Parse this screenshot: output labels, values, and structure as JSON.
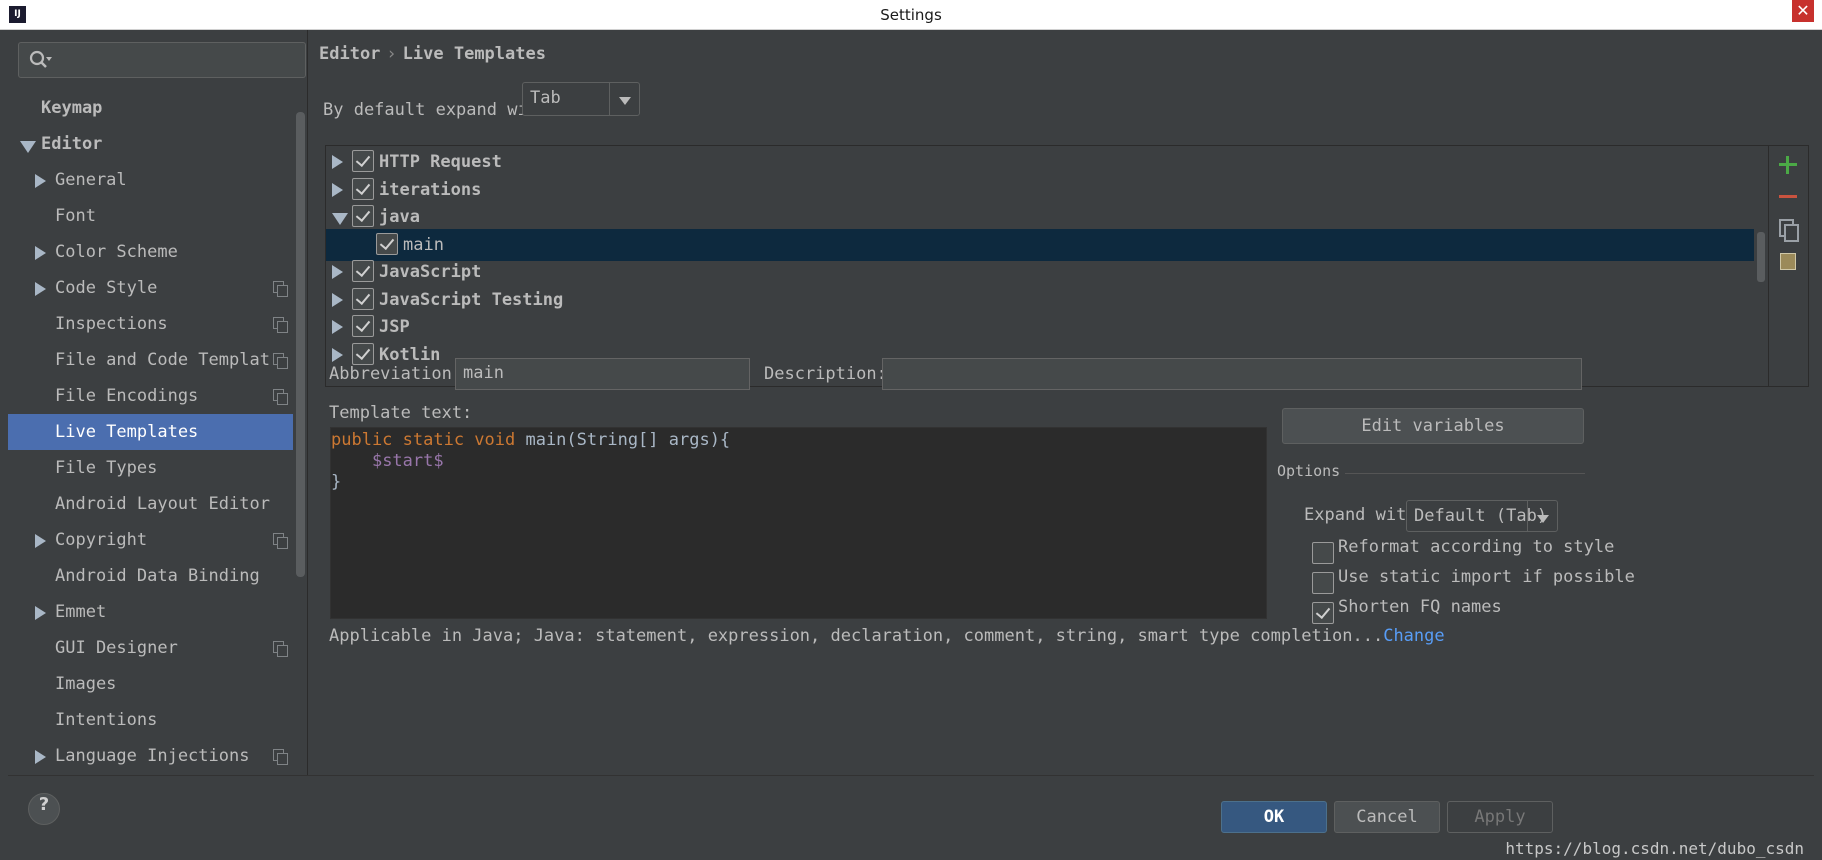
{
  "window": {
    "title": "Settings",
    "app_icon": "IJ"
  },
  "search": {
    "placeholder": ""
  },
  "sidebar": {
    "items": [
      {
        "label": "Keymap",
        "level": 0,
        "expander": "none",
        "bold": true,
        "selected": false,
        "has_copy_icon": false
      },
      {
        "label": "Editor",
        "level": 0,
        "expander": "down",
        "bold": true,
        "selected": false,
        "has_copy_icon": false
      },
      {
        "label": "General",
        "level": 1,
        "expander": "right",
        "bold": false,
        "selected": false,
        "has_copy_icon": false
      },
      {
        "label": "Font",
        "level": 1,
        "expander": "none",
        "bold": false,
        "selected": false,
        "has_copy_icon": false
      },
      {
        "label": "Color Scheme",
        "level": 1,
        "expander": "right",
        "bold": false,
        "selected": false,
        "has_copy_icon": false
      },
      {
        "label": "Code Style",
        "level": 1,
        "expander": "right",
        "bold": false,
        "selected": false,
        "has_copy_icon": true
      },
      {
        "label": "Inspections",
        "level": 1,
        "expander": "none",
        "bold": false,
        "selected": false,
        "has_copy_icon": true
      },
      {
        "label": "File and Code Templat",
        "level": 1,
        "expander": "none",
        "bold": false,
        "selected": false,
        "has_copy_icon": true
      },
      {
        "label": "File Encodings",
        "level": 1,
        "expander": "none",
        "bold": false,
        "selected": false,
        "has_copy_icon": true
      },
      {
        "label": "Live Templates",
        "level": 1,
        "expander": "none",
        "bold": false,
        "selected": true,
        "has_copy_icon": false
      },
      {
        "label": "File Types",
        "level": 1,
        "expander": "none",
        "bold": false,
        "selected": false,
        "has_copy_icon": false
      },
      {
        "label": "Android Layout Editor",
        "level": 1,
        "expander": "none",
        "bold": false,
        "selected": false,
        "has_copy_icon": false
      },
      {
        "label": "Copyright",
        "level": 1,
        "expander": "right",
        "bold": false,
        "selected": false,
        "has_copy_icon": true
      },
      {
        "label": "Android Data Binding",
        "level": 1,
        "expander": "none",
        "bold": false,
        "selected": false,
        "has_copy_icon": false
      },
      {
        "label": "Emmet",
        "level": 1,
        "expander": "right",
        "bold": false,
        "selected": false,
        "has_copy_icon": false
      },
      {
        "label": "GUI Designer",
        "level": 1,
        "expander": "none",
        "bold": false,
        "selected": false,
        "has_copy_icon": true
      },
      {
        "label": "Images",
        "level": 1,
        "expander": "none",
        "bold": false,
        "selected": false,
        "has_copy_icon": false
      },
      {
        "label": "Intentions",
        "level": 1,
        "expander": "none",
        "bold": false,
        "selected": false,
        "has_copy_icon": false
      },
      {
        "label": "Language Injections",
        "level": 1,
        "expander": "right",
        "bold": false,
        "selected": false,
        "has_copy_icon": true
      }
    ]
  },
  "breadcrumb": {
    "parent": "Editor",
    "separator": "›",
    "current": "Live Templates"
  },
  "expand": {
    "label": "By default expand with",
    "value": "Tab"
  },
  "templates": [
    {
      "label": "HTTP Request",
      "level": 0,
      "expander": "right",
      "checked": true,
      "bold": true,
      "selected": false
    },
    {
      "label": "iterations",
      "level": 0,
      "expander": "right",
      "checked": true,
      "bold": true,
      "selected": false
    },
    {
      "label": "java",
      "level": 0,
      "expander": "down",
      "checked": true,
      "bold": true,
      "selected": false
    },
    {
      "label": "main",
      "level": 1,
      "expander": "none",
      "checked": true,
      "bold": false,
      "selected": true
    },
    {
      "label": "JavaScript",
      "level": 0,
      "expander": "right",
      "checked": true,
      "bold": true,
      "selected": false
    },
    {
      "label": "JavaScript Testing",
      "level": 0,
      "expander": "right",
      "checked": true,
      "bold": true,
      "selected": false
    },
    {
      "label": "JSP",
      "level": 0,
      "expander": "right",
      "checked": true,
      "bold": true,
      "selected": false
    },
    {
      "label": "Kotlin",
      "level": 0,
      "expander": "right",
      "checked": true,
      "bold": true,
      "selected": false
    }
  ],
  "toolbar": {
    "add": "plus-icon",
    "remove": "minus-icon",
    "copy": "duplicate-icon",
    "restore": "restore-icon"
  },
  "form": {
    "abbreviation_label": "Abbreviation:",
    "abbreviation_value": "main",
    "description_label": "Description:",
    "description_value": "",
    "template_text_label": "Template text:"
  },
  "code": {
    "line1_kw": "public static void",
    "line1_rest": " main(String[] args){",
    "line2_indent": "    ",
    "line2_var": "$start$",
    "line3": "}"
  },
  "options": {
    "edit_variables_label": "Edit variables",
    "title": "Options",
    "expand_with_label": "Expand with",
    "expand_with_value": "Default (Tab)",
    "checkboxes": [
      {
        "label": "Reformat according to style",
        "checked": false
      },
      {
        "label": "Use static import if possible",
        "checked": false
      },
      {
        "label": "Shorten FQ names",
        "checked": true
      }
    ]
  },
  "applicable": {
    "text": "Applicable in Java; Java: statement, expression, declaration, comment, string, smart type completion...",
    "change_link": "Change"
  },
  "footer": {
    "help": "?",
    "ok": "OK",
    "cancel": "Cancel",
    "apply": "Apply"
  },
  "watermark": "https://blog.csdn.net/dubo_csdn",
  "colors": {
    "background": "#3c3f41",
    "selection": "#4b6eaf",
    "list_selection": "#0d293e",
    "keyword": "#cc7832",
    "template_var": "#9876aa",
    "link": "#589df6"
  }
}
